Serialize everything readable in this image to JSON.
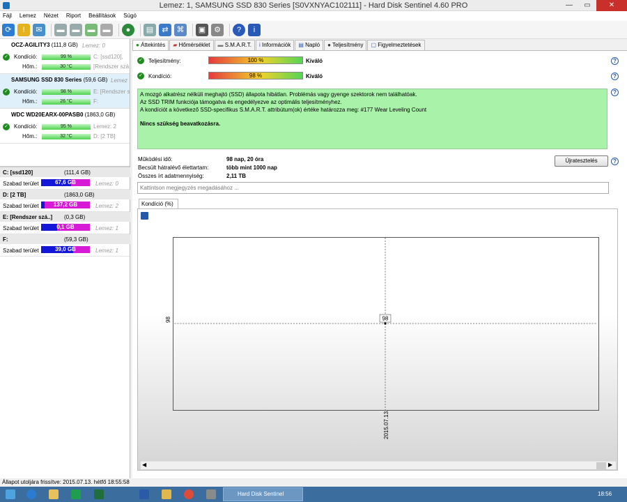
{
  "window": {
    "title": "Lemez: 1, SAMSUNG SSD 830 Series [S0VXNYAC102111]  -  Hard Disk Sentinel 4.60 PRO",
    "min": "—",
    "max": "▭",
    "close": "✕"
  },
  "menu": [
    "Fájl",
    "Lemez",
    "Nézet",
    "Riport",
    "Beállítások",
    "Súgó"
  ],
  "disks": [
    {
      "name": "OCZ-AGILITY3",
      "size": "(111,8 GB)",
      "lemez": "Lemez: 0",
      "kondicio_label": "Kondíció:",
      "kondicio": "99 %",
      "kondicio_side": "C: [ssd120],",
      "hom_label": "Hőm.:",
      "hom": "30 °C",
      "hom_side": "[Rendszer szá"
    },
    {
      "name": "SAMSUNG SSD 830 Series",
      "size": "(59,6 GB)",
      "lemez": "Lemez",
      "kondicio_label": "Kondíció:",
      "kondicio": "98 %",
      "kondicio_side": "E: [Rendszer s",
      "hom_label": "Hőm.:",
      "hom": "26 °C",
      "hom_side": "F:"
    },
    {
      "name": "WDC WD20EARX-00PASB0",
      "size": "(1863,0 GB)",
      "lemez": "",
      "kondicio_label": "Kondíció:",
      "kondicio": "95 %",
      "kondicio_side": "Lemez: 2",
      "hom_label": "Hőm.:",
      "hom": "32 °C",
      "hom_side": "D: [2 TB]"
    }
  ],
  "partitions": [
    {
      "name": "C: [ssd120]",
      "size": "(111,4 GB)",
      "label": "Szabad terület",
      "free": "67,6 GB",
      "free_fraction": 0.61,
      "lemez": "Lemez: 0"
    },
    {
      "name": "D: [2 TB]",
      "size": "(1863,0 GB)",
      "label": "Szabad terület",
      "free": "137,2 GB",
      "free_fraction": 0.07,
      "lemez": "Lemez: 2"
    },
    {
      "name": "E: [Rendszer szá..]",
      "size": "(0,3 GB)",
      "label": "Szabad terület",
      "free": "0,1 GB",
      "free_fraction": 0.33,
      "lemez": "Lemez: 1"
    },
    {
      "name": "F:",
      "size": "(59,3 GB)",
      "label": "Szabad terület",
      "free": "39,0 GB",
      "free_fraction": 0.66,
      "lemez": "Lemez: 1"
    }
  ],
  "tabs": [
    "Áttekintés",
    "Hőmérséklet",
    "S.M.A.R.T.",
    "Információk",
    "Napló",
    "Teljesítmény",
    "Figyelmeztetések"
  ],
  "overview": {
    "teljesitmeny_label": "Teljesítmény:",
    "teljesitmeny": "100 %",
    "teljesitmeny_rating": "Kiváló",
    "kondicio_label": "Kondíció:",
    "kondicio": "98 %",
    "kondicio_rating": "Kiváló",
    "msg1": "A mozgó alkatrész nélküli meghajtó (SSD) állapota hibátlan. Problémás vagy gyenge szektorok nem találhatóak.",
    "msg2": "Az SSD TRIM funkciója támogatva és engedélyezve az optimális teljesítményhez.",
    "msg3": "A kondíciót a következő SSD-specifikus S.M.A.R.T. attribútum(ok) értéke határozza meg:  #177 Wear Leveling Count",
    "msg4": "Nincs szükség beavatkozásra.",
    "mukodesi_label": "Működési idő:",
    "mukodesi": "98 nap, 20 óra",
    "becsult_label": "Becsült hátralévő élettartam:",
    "becsult": "több mint 1000 nap",
    "osszes_label": "Összes írt adatmennyiség:",
    "osszes": "2,11 TB",
    "reset_button": "Újratesztelés",
    "note_placeholder": "Kattintson megjegyzés megadásához ...",
    "graph_tab": "Kondíció  (%)",
    "help": "?"
  },
  "chart_data": {
    "type": "line",
    "x": [
      "2015.07.13."
    ],
    "series": [
      {
        "values": [
          98
        ]
      }
    ],
    "ylabel": "98",
    "xlabel": "2015.07.13.",
    "point_label": "98"
  },
  "status": "Állapot utoljára frissítve: 2015.07.13. hétfő 18:55:58",
  "taskbar": {
    "app": "Hard Disk Sentinel",
    "clock": "18:56"
  }
}
